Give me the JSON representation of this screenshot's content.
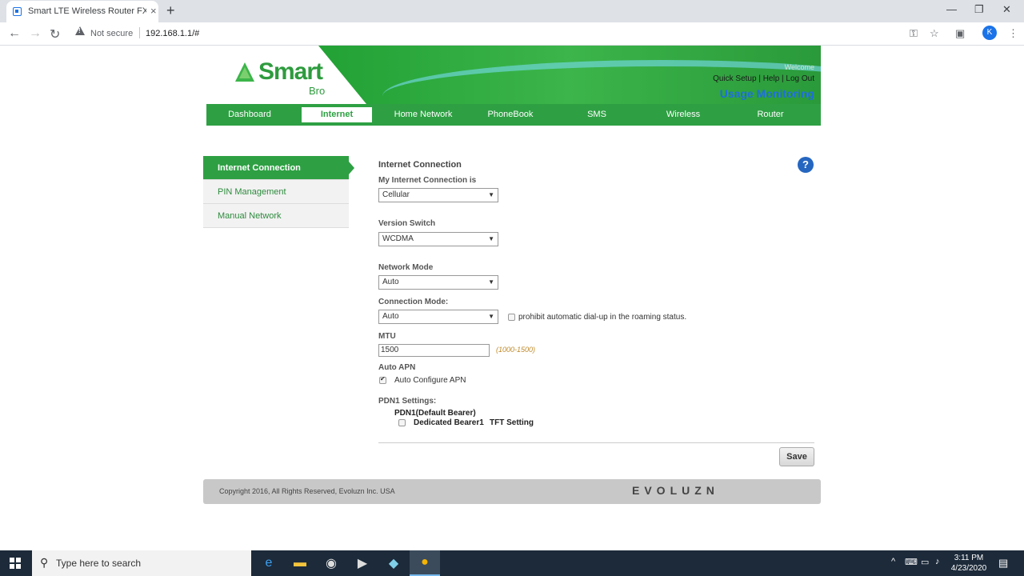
{
  "browser": {
    "tab_title": "Smart LTE Wireless Router FX PRO",
    "tab_close": "×",
    "new_tab": "+",
    "security_label": "Not secure",
    "url": "192.168.1.1/#",
    "profile_initial": "K"
  },
  "header": {
    "logo_text": "Smart",
    "logo_sub": "Bro",
    "welcome": "Welcome",
    "quick_links": "Quick Setup | Help | Log Out",
    "usage_monitoring": "Usage Monitoring"
  },
  "nav": {
    "items": [
      {
        "label": "Dashboard"
      },
      {
        "label": "Internet"
      },
      {
        "label": "Home Network"
      },
      {
        "label": "PhoneBook"
      },
      {
        "label": "SMS"
      },
      {
        "label": "Wireless"
      },
      {
        "label": "Router"
      }
    ],
    "active": "Internet"
  },
  "sidebar": {
    "items": [
      {
        "label": "Internet Connection"
      },
      {
        "label": "PIN Management"
      },
      {
        "label": "Manual Network"
      }
    ]
  },
  "form": {
    "title": "Internet Connection",
    "connection_label": "My Internet Connection is",
    "connection_value": "Cellular",
    "version_label": "Version Switch",
    "version_value": "WCDMA",
    "network_mode_label": "Network Mode",
    "network_mode_value": "Auto",
    "connection_mode_label": "Connection Mode:",
    "connection_mode_value": "Auto",
    "roaming_label": "prohibit automatic dial-up in the roaming status.",
    "roaming_checked": false,
    "mtu_label": "MTU",
    "mtu_value": "1500",
    "mtu_hint": "(1000-1500)",
    "auto_apn_label": "Auto APN",
    "auto_configure_label": "Auto Configure APN",
    "auto_configure_checked": true,
    "pdn1_label": "PDN1 Settings:",
    "pdn1_default": "PDN1(Default Bearer)",
    "dedicated_label": "Dedicated Bearer1",
    "tft_label": "TFT Setting",
    "save_label": "Save",
    "help_label": "?"
  },
  "footer": {
    "copyright": "Copyright 2016, All Rights Reserved, Evoluzn Inc. USA",
    "brand": "EVOLUZN"
  },
  "taskbar": {
    "search_placeholder": "Type here to search",
    "time": "3:11 PM",
    "date": "4/23/2020"
  },
  "colors": {
    "brand_green": "#2ea043",
    "link_blue": "#1e6fd8",
    "help_blue": "#2566c0"
  }
}
